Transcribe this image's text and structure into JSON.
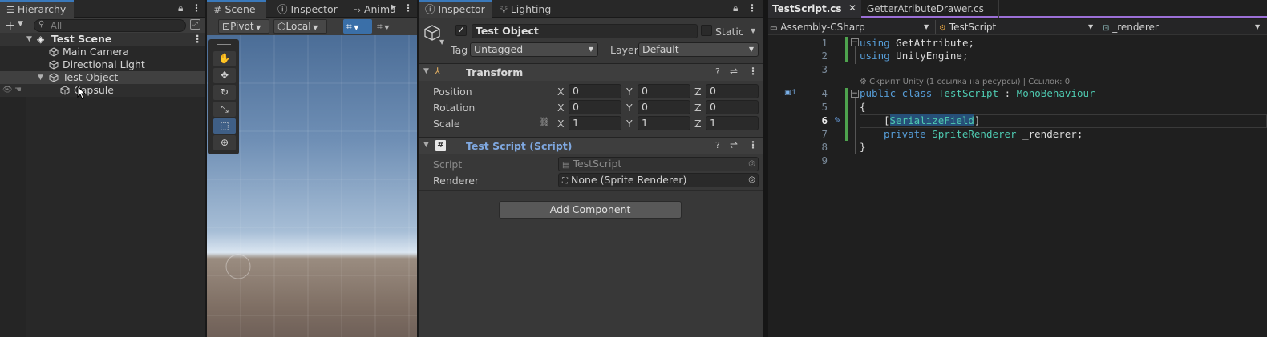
{
  "hierarchy": {
    "tab_label": "Hierarchy",
    "search_placeholder": "All",
    "scene_name": "Test Scene",
    "items": [
      "Main Camera",
      "Directional Light",
      "Test Object",
      "Capsule"
    ]
  },
  "scene_view": {
    "tabs": [
      "Scene",
      "Inspector",
      "Anima"
    ],
    "pivot_label": "Pivot",
    "local_label": "Local"
  },
  "inspector": {
    "tabs": [
      "Inspector",
      "Lighting"
    ],
    "object_name": "Test Object",
    "object_active": true,
    "static_label": "Static",
    "tag_label": "Tag",
    "tag_value": "Untagged",
    "layer_label": "Layer",
    "layer_value": "Default",
    "transform": {
      "title": "Transform",
      "rows": [
        {
          "label": "Position",
          "x": "0",
          "y": "0",
          "z": "0"
        },
        {
          "label": "Rotation",
          "x": "0",
          "y": "0",
          "z": "0"
        },
        {
          "label": "Scale",
          "x": "1",
          "y": "1",
          "z": "1"
        }
      ],
      "axis_x": "X",
      "axis_y": "Y",
      "axis_z": "Z"
    },
    "script_component": {
      "title": "Test Script (Script)",
      "script_label": "Script",
      "script_value": "TestScript",
      "renderer_label": "Renderer",
      "renderer_value": "None (Sprite Renderer)"
    },
    "add_component": "Add Component"
  },
  "editor": {
    "tabs": [
      "TestScript.cs",
      "GetterAtributeDrawer.cs"
    ],
    "project_dropdown": "Assembly-CSharp",
    "class_dropdown": "TestScript",
    "member_dropdown": "_renderer",
    "codelens": "Скрипт Unity (1 ссылка на ресурсы) | Ссылок: 0",
    "line_numbers": [
      "1",
      "2",
      "3",
      "4",
      "5",
      "6",
      "7",
      "8",
      "9"
    ],
    "lines": {
      "l1_kw": "using",
      "l1_rest": " GetAttribute;",
      "l2_kw": "using",
      "l2_rest": " UnityEngine;",
      "l4_kw": "public class",
      "l4_name": "TestScript",
      "l4_colon": " : ",
      "l4_base": "MonoBehaviour",
      "l5": "{",
      "l6_open": "[",
      "l6_attr": "SerializeField",
      "l6_close": "]",
      "l7_kw": "private",
      "l7_type": "SpriteRenderer",
      "l7_rest": " _renderer;",
      "l8": "}"
    }
  },
  "colors": {
    "accent": "#3a79bb",
    "editor_tab_active": "#9b6fd6",
    "git_bar": "#4ea34e"
  }
}
